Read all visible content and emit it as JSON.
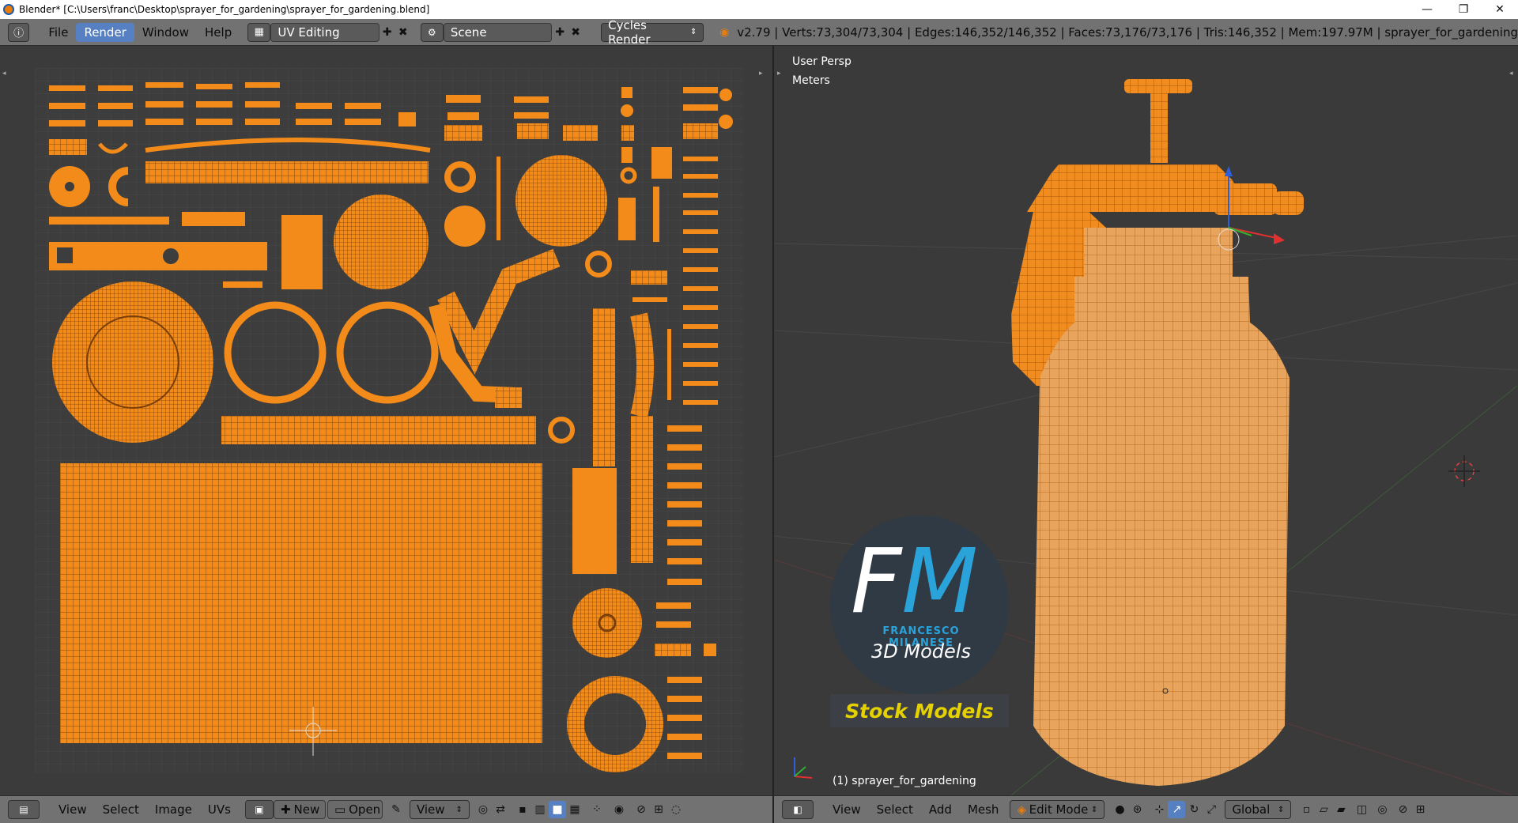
{
  "window": {
    "title": "Blender* [C:\\Users\\franc\\Desktop\\sprayer_for_gardening\\sprayer_for_gardening.blend]",
    "minimize": "—",
    "maximize": "❐",
    "close": "✕"
  },
  "info_header": {
    "menus": [
      "File",
      "Render",
      "Window",
      "Help"
    ],
    "active_menu": "Render",
    "screen_layout": "UV Editing",
    "scene": "Scene",
    "render_engine": "Cycles Render",
    "stats": "v2.79 | Verts:73,304/73,304 | Edges:146,352/146,352 | Faces:73,176/73,176 | Tris:146,352 | Mem:197.97M | sprayer_for_gardening"
  },
  "uv_editor_footer": {
    "menus": [
      "View",
      "Select",
      "Image",
      "UVs"
    ],
    "new_label": "New",
    "open_label": "Open",
    "view_dropdown": "View"
  },
  "viewport": {
    "view_name": "User Persp",
    "units": "Meters",
    "object_label": "(1) sprayer_for_gardening",
    "logo": {
      "initials_f": "F",
      "initials_m": "M",
      "name": "FRANCESCO MILANESE",
      "tagline": "3D Models",
      "stock": "Stock Models"
    }
  },
  "view3d_footer": {
    "menus": [
      "View",
      "Select",
      "Add",
      "Mesh"
    ],
    "mode": "Edit Mode",
    "orientation": "Global"
  },
  "colors": {
    "accent_orange": "#f28b1a",
    "menu_active_blue": "#5680c2",
    "logo_blue": "#2aa3db",
    "stock_yellow": "#e6d100"
  }
}
